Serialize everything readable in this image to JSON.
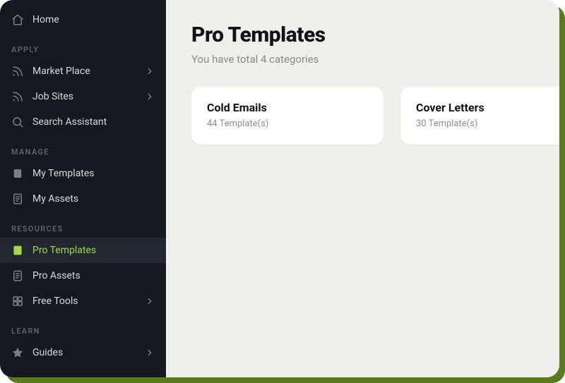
{
  "sidebar": {
    "home": {
      "label": "Home"
    },
    "sections": {
      "apply": {
        "heading": "APPLY",
        "items": [
          {
            "label": "Market Place",
            "expandable": true
          },
          {
            "label": "Job Sites",
            "expandable": true
          },
          {
            "label": "Search Assistant",
            "expandable": false
          }
        ]
      },
      "manage": {
        "heading": "MANAGE",
        "items": [
          {
            "label": "My Templates"
          },
          {
            "label": "My Assets"
          }
        ]
      },
      "resources": {
        "heading": "RESOURCES",
        "items": [
          {
            "label": "Pro Templates",
            "active": true
          },
          {
            "label": "Pro Assets"
          },
          {
            "label": "Free Tools",
            "expandable": true
          }
        ]
      },
      "learn": {
        "heading": "LEARN",
        "items": [
          {
            "label": "Guides",
            "expandable": true
          }
        ]
      }
    }
  },
  "main": {
    "title": "Pro Templates",
    "subtitle": "You have total 4 categories",
    "cards": [
      {
        "title": "Cold Emails",
        "subtitle": "44 Template(s)"
      },
      {
        "title": "Cover Letters",
        "subtitle": "30 Template(s)"
      }
    ]
  }
}
